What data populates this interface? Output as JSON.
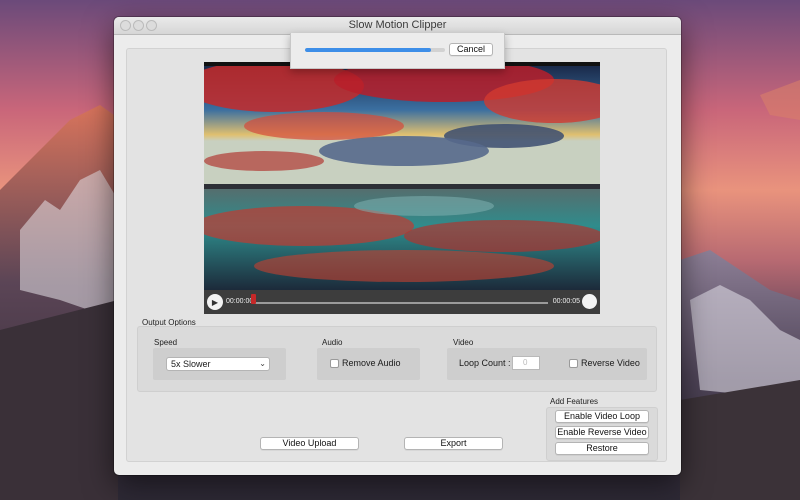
{
  "window": {
    "title": "Slow Motion Clipper"
  },
  "progress_sheet": {
    "progress_fraction": 0.9,
    "cancel_label": "Cancel",
    "fill_color": "#3d8ee8"
  },
  "video": {
    "current_time": "00:00:00",
    "end_time": "00:00:05",
    "play_icon": "play-icon"
  },
  "output_options": {
    "label": "Output Options",
    "speed": {
      "label": "Speed",
      "selected": "5x Slower"
    },
    "audio": {
      "label": "Audio",
      "remove_audio_label": "Remove Audio",
      "remove_audio_checked": false
    },
    "video": {
      "label": "Video",
      "loop_count_label": "Loop Count :",
      "loop_count_value": "0",
      "reverse_video_label": "Reverse Video",
      "reverse_video_checked": false
    }
  },
  "add_features": {
    "label": "Add Features",
    "enable_video_loop": "Enable Video Loop",
    "enable_reverse_video": "Enable Reverse Video",
    "restore": "Restore"
  },
  "actions": {
    "video_upload": "Video Upload",
    "export": "Export"
  }
}
